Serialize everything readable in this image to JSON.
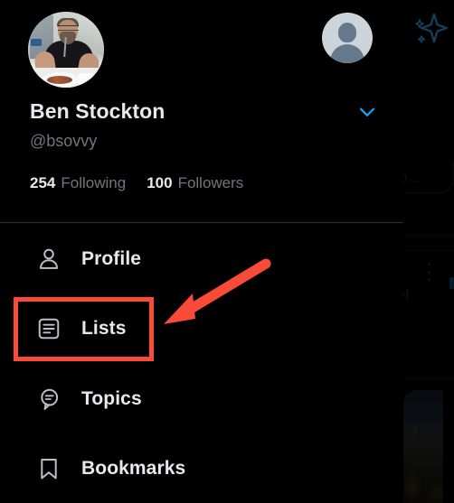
{
  "app": {
    "theme": "dark",
    "background_color": "#000000",
    "accent_color": "#1d9bf0",
    "text_primary": "#e7e9ea",
    "text_secondary": "#71767b",
    "divider_color": "#2f3336",
    "annotation_color": "#fa4b38"
  },
  "account": {
    "display_name": "Ben Stockton",
    "handle": "@bsovvy",
    "avatar_name": "user-profile-photo",
    "alt_avatar_name": "default-account-avatar",
    "switch_accounts_icon": "chevron-down-icon",
    "stats": [
      {
        "count": "254",
        "label": "Following",
        "name": "following"
      },
      {
        "count": "100",
        "label": "Followers",
        "name": "followers"
      }
    ]
  },
  "nav": {
    "items": [
      {
        "label": "Profile",
        "icon": "person-icon",
        "name": "profile",
        "highlighted": false
      },
      {
        "label": "Lists",
        "icon": "lists-icon",
        "name": "lists",
        "highlighted": true
      },
      {
        "label": "Topics",
        "icon": "topics-icon",
        "name": "topics",
        "highlighted": false
      },
      {
        "label": "Bookmarks",
        "icon": "bookmark-icon",
        "name": "bookmarks",
        "highlighted": false
      }
    ]
  },
  "annotations": {
    "highlight_target": "Lists",
    "highlight_color": "#fa4b38",
    "arrow_color": "#fa4b38",
    "arrow_direction": "down-left"
  },
  "background": {
    "sparkle_icon": "sparkle-icon",
    "overflow_icon": "more-options-icon",
    "text_snippets": [
      {
        "text": "p…",
        "name": "bg-snippet-top"
      },
      {
        "text": "of",
        "name": "bg-snippet-middle"
      }
    ],
    "photo_name": "timeline-photo-thumbnail"
  }
}
